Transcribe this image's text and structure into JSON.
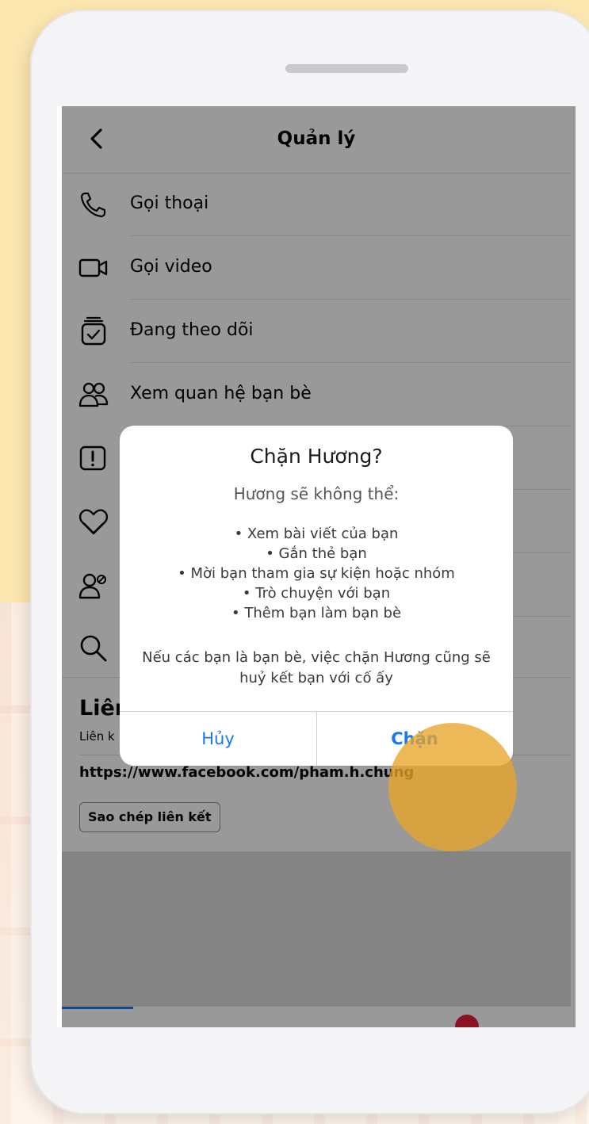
{
  "nav": {
    "title": "Quản lý"
  },
  "menu": [
    {
      "label": "Gọi thoại",
      "icon": "phone-icon"
    },
    {
      "label": "Gọi video",
      "icon": "video-icon"
    },
    {
      "label": "Đang theo dõi",
      "icon": "following-icon"
    },
    {
      "label": "Xem quan hệ bạn bè",
      "icon": "friends-icon"
    },
    {
      "label": "",
      "icon": "report-icon"
    },
    {
      "label": "",
      "icon": "heart-icon"
    },
    {
      "label": "",
      "icon": "block-user-icon"
    },
    {
      "label": "",
      "icon": "search-icon"
    }
  ],
  "link_section": {
    "title": "Liên",
    "subtitle": "Liên k",
    "url": "https://www.facebook.com/pham.h.chung",
    "copy_label": "Sao chép liên kết"
  },
  "dialog": {
    "title": "Chặn Hương?",
    "subtitle": "Hương sẽ không thể:",
    "items": [
      "• Xem bài viết của bạn",
      "• Gắn thẻ bạn",
      "• Mời bạn tham gia sự kiện hoặc nhóm",
      "• Trò chuyện với bạn",
      "• Thêm bạn làm bạn bè"
    ],
    "note": "Nếu các bạn là bạn bè, việc chặn Hương cũng sẽ huỷ kết bạn với cố ấy",
    "cancel_label": "Hủy",
    "confirm_label": "Chặn"
  },
  "colors": {
    "accent": "#1877f2",
    "tap_highlight": "#e8a428",
    "overlay": "rgba(0,0,0,0.40)"
  }
}
